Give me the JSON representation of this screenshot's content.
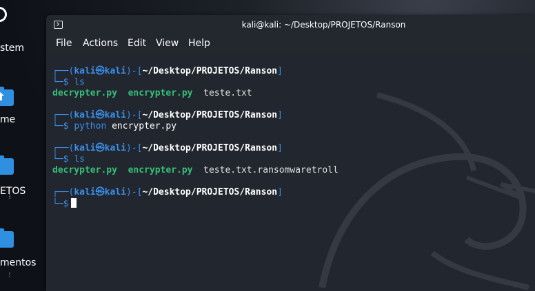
{
  "desktop": {
    "icons": [
      {
        "label": "stem"
      },
      {
        "label": "me"
      },
      {
        "label": "ETOS"
      },
      {
        "label": "mentos"
      }
    ]
  },
  "window": {
    "title": "kali@kali: ~/Desktop/PROJETOS/Ranson",
    "menu": [
      "File",
      "Actions",
      "Edit",
      "View",
      "Help"
    ]
  },
  "terminal": {
    "prompt": {
      "open": "┌──(",
      "user": "kali",
      "at": "㉿",
      "host": "kali",
      "sep": ")-[",
      "path": "~/Desktop/PROJETOS/Ranson",
      "close": "]",
      "cont": "└─",
      "dollar": "$"
    },
    "commands": [
      {
        "text": "ls",
        "parts": [
          "ls"
        ]
      },
      {
        "parts": [
          "python",
          "encrypter.py"
        ]
      },
      {
        "parts": [
          "ls"
        ]
      },
      {
        "parts": []
      }
    ],
    "outputs": [
      [
        "decrypter.py",
        "encrypter.py",
        "teste.txt"
      ],
      [
        "decrypter.py",
        "encrypter.py",
        "teste.txt.ransomwaretroll"
      ]
    ]
  },
  "colors": {
    "prompt": "#3b8eea",
    "executable": "#35c07a",
    "background": "#22262e"
  }
}
